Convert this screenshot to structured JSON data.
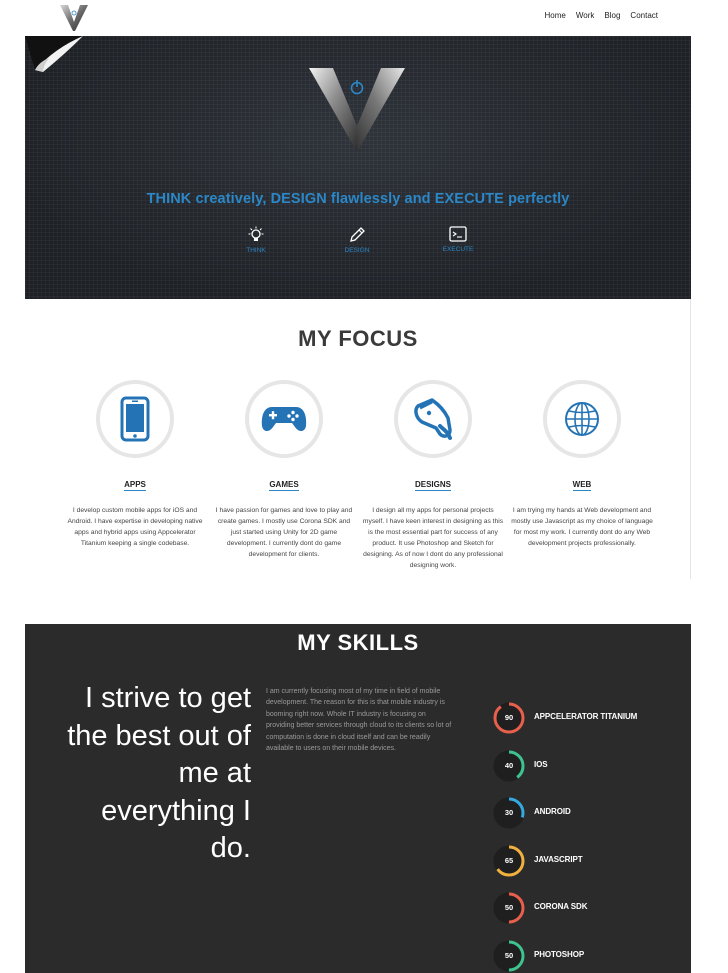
{
  "nav": {
    "items": [
      "Home",
      "Work",
      "Blog",
      "Contact"
    ]
  },
  "hero": {
    "tagline": "THINK creatively, DESIGN flawlessly and EXECUTE perfectly",
    "icons": [
      {
        "label": "THINK",
        "icon": "lightbulb-icon"
      },
      {
        "label": "DESIGN",
        "icon": "pencil-icon"
      },
      {
        "label": "EXECUTE",
        "icon": "terminal-icon"
      }
    ],
    "accent": "#2b87c7"
  },
  "focus": {
    "title": "MY FOCUS",
    "items": [
      {
        "title": "APPS",
        "icon": "phone-icon",
        "desc": "I develop custom mobile apps for iOS and Android. I have expertise in developing native apps and hybrid apps using Appcelerator Titanium keeping a single codebase."
      },
      {
        "title": "GAMES",
        "icon": "gamepad-icon",
        "desc": "I have passion for games and love to play and create games. I mostly use Corona SDK and just started using Unity for 2D game development. I currently dont do game development for clients."
      },
      {
        "title": "DESIGNS",
        "icon": "paint-bucket-icon",
        "desc": "I design all my apps for personal projects myself. I have keen interest in designing as this is the most essential part for success of any product. It use Photoshop and Sketch for designing. As of now I dont do any professional designing work."
      },
      {
        "title": "WEB",
        "icon": "globe-icon",
        "desc": "I am trying my hands at Web development and mostly use Javascript as my choice of language for most my work. I currently dont do any Web development projects professionally."
      }
    ]
  },
  "skills": {
    "title": "MY SKILLS",
    "quote": "I strive to get the best out of me at everything I do.",
    "text": "I am currently focusing most of my time in field of mobile development. The reason for this is that mobile industry is booming right now. Whole IT industry is focusing on providing better services through cloud to its clients so lot of computation is done in cloud itself and can be readily available to users on their mobile devices.",
    "items": [
      {
        "name": "APPCELERATOR TITANIUM",
        "value": 90,
        "color": "#e8604c"
      },
      {
        "name": "IOS",
        "value": 40,
        "color": "#3ec28f"
      },
      {
        "name": "ANDROID",
        "value": 30,
        "color": "#34a9e0"
      },
      {
        "name": "JAVASCRIPT",
        "value": 65,
        "color": "#f0b13f"
      },
      {
        "name": "CORONA SDK",
        "value": 50,
        "color": "#e8604c"
      },
      {
        "name": "PHOTOSHOP",
        "value": 50,
        "color": "#3ec28f"
      }
    ]
  }
}
